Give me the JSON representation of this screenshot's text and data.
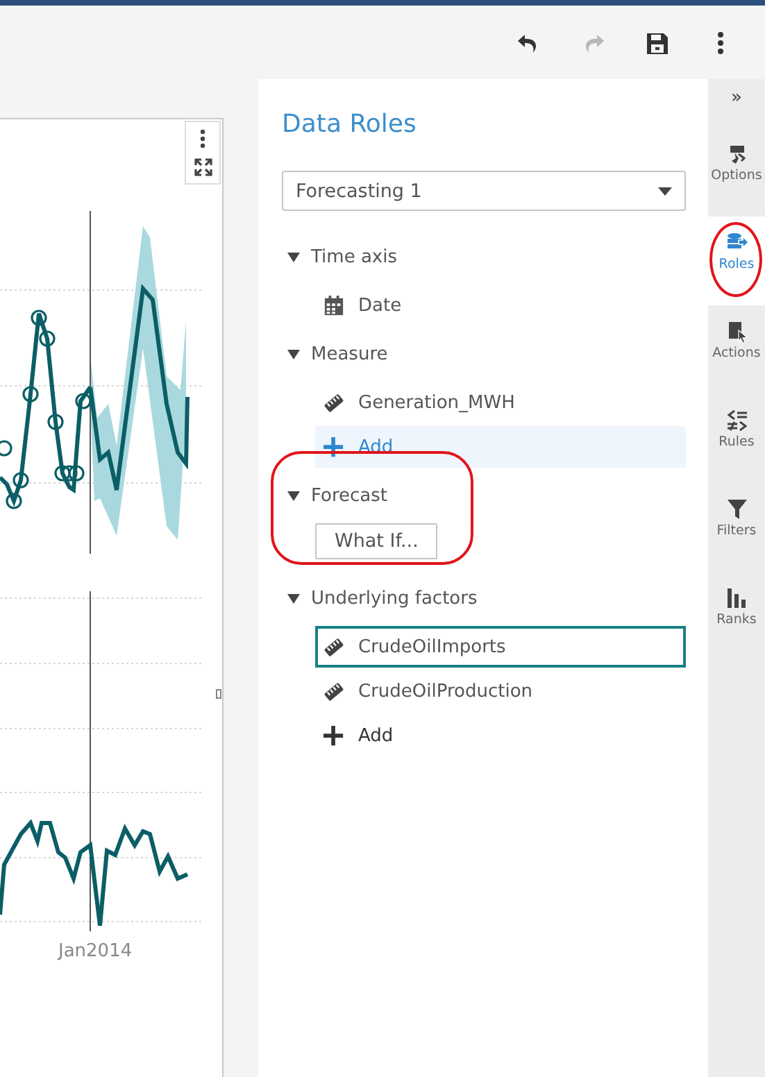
{
  "toolbar": {
    "buttons": [
      {
        "kind": "undo",
        "disabled": false
      },
      {
        "kind": "redo",
        "disabled": true
      },
      {
        "kind": "save",
        "disabled": false
      },
      {
        "kind": "more",
        "disabled": false
      }
    ]
  },
  "chart": {
    "x_label": "Jan2014"
  },
  "panel": {
    "title": "Data Roles",
    "dropdown": {
      "value": "Forecasting 1"
    },
    "sections": [
      {
        "label": "Time axis",
        "expanded": true,
        "circled": false,
        "items": [
          {
            "kind": "date",
            "label": "Date",
            "selected": false,
            "hovered": false
          }
        ]
      },
      {
        "label": "Measure",
        "expanded": true,
        "circled": false,
        "items": [
          {
            "kind": "measure",
            "label": "Generation_MWH",
            "selected": false,
            "hovered": false
          },
          {
            "kind": "add",
            "label": "Add",
            "selected": false,
            "hovered": true
          }
        ]
      },
      {
        "label": "Forecast",
        "expanded": true,
        "circled": true,
        "items": [
          {
            "kind": "button",
            "label": "What If..."
          }
        ]
      },
      {
        "label": "Underlying factors",
        "expanded": true,
        "circled": false,
        "items": [
          {
            "kind": "measure",
            "label": "CrudeOilImports",
            "selected": true,
            "hovered": false
          },
          {
            "kind": "measure",
            "label": "CrudeOilProduction",
            "selected": false,
            "hovered": false
          },
          {
            "kind": "add",
            "label": "Add",
            "selected": false,
            "hovered": false
          }
        ]
      }
    ]
  },
  "sidebar": {
    "toggle": "»",
    "tabs": [
      {
        "kind": "options",
        "label": "Options",
        "selected": false,
        "circled": false
      },
      {
        "kind": "roles",
        "label": "Roles",
        "selected": true,
        "circled": true
      },
      {
        "kind": "actions",
        "label": "Actions",
        "selected": false,
        "circled": false
      },
      {
        "kind": "rules",
        "label": "Rules",
        "selected": false,
        "circled": false
      },
      {
        "kind": "filters",
        "label": "Filters",
        "selected": false,
        "circled": false
      },
      {
        "kind": "ranks",
        "label": "Ranks",
        "selected": false,
        "circled": false
      }
    ]
  }
}
